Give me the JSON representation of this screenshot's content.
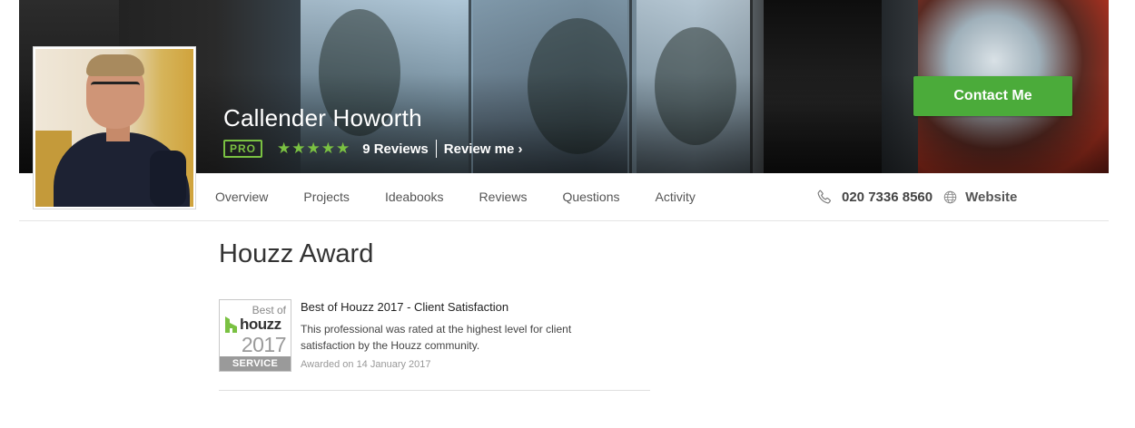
{
  "profile": {
    "name": "Callender Howorth",
    "pro_badge": "PRO",
    "stars": "★★★★★",
    "rating": 5,
    "reviews_label": "9 Reviews",
    "review_me_label": "Review me ›",
    "contact_button": "Contact Me"
  },
  "nav": {
    "tabs": [
      "Overview",
      "Projects",
      "Ideabooks",
      "Reviews",
      "Questions",
      "Activity"
    ],
    "phone": "020 7336 8560",
    "website": "Website"
  },
  "award_section": {
    "title": "Houzz Award",
    "badge": {
      "best_of": "Best of",
      "brand": "houzz",
      "year": "2017",
      "category": "SERVICE"
    },
    "award_title": "Best of Houzz 2017 - Client Satisfaction",
    "description": "This professional was rated at the highest level for client satisfaction by the Houzz community.",
    "awarded_on": "Awarded on 14 January 2017"
  },
  "colors": {
    "accent_green": "#4bab3a",
    "pro_green": "#7ac142"
  },
  "icons": [
    "phone-icon",
    "globe-icon",
    "houzz-logo-icon"
  ]
}
